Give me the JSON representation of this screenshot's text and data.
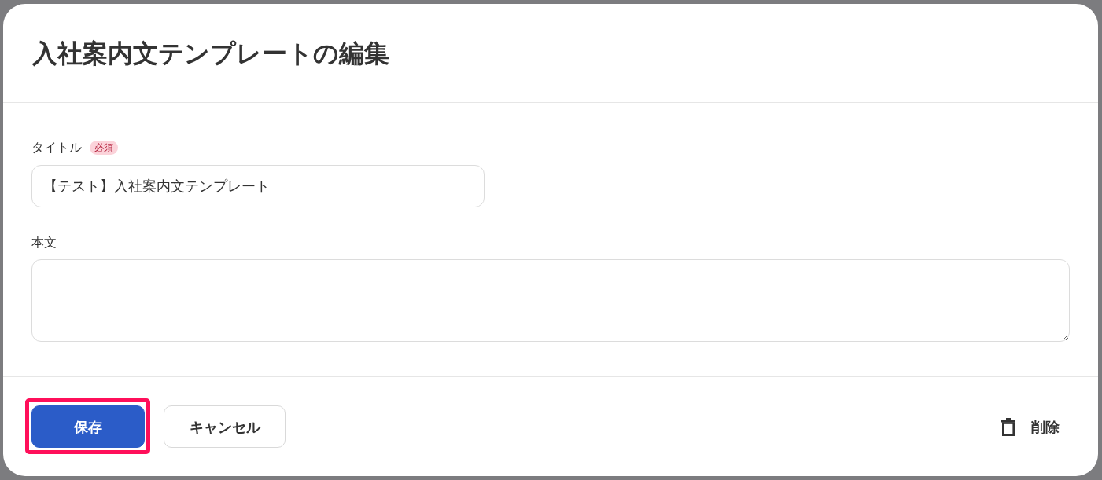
{
  "dialog": {
    "title": "入社案内文テンプレートの編集"
  },
  "fields": [
    {
      "kind": "text",
      "label": "タイトル",
      "badge": "必須",
      "value": "【テスト】入社案内文テンプレート"
    },
    {
      "kind": "textarea",
      "label": "本文"
    }
  ],
  "footer": {
    "buttons": [
      {
        "kind": "primary",
        "label": "保存",
        "highlighted": true
      },
      {
        "kind": "secondary",
        "label": "キャンセル",
        "highlighted": false
      }
    ],
    "delete_button": {
      "label": "削除"
    }
  }
}
